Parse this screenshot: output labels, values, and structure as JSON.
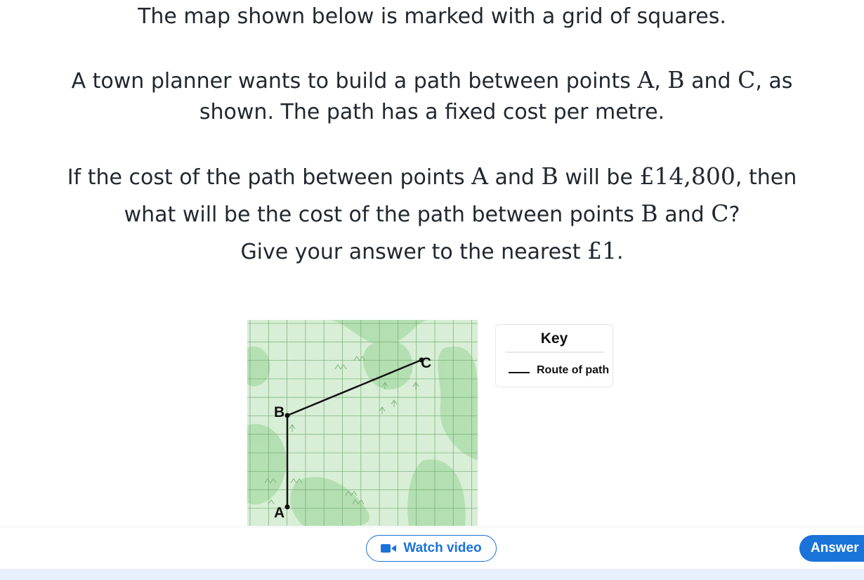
{
  "question": {
    "line1": "The map shown below is marked with a grid of squares.",
    "line2": {
      "pre": "A town planner wants to build a path between points ",
      "a": "A",
      "sep1": ", ",
      "b": "B",
      "and": " and ",
      "c": "C",
      "post": ", as"
    },
    "line3": "shown. The path has a fixed cost per metre.",
    "line4": {
      "pre": "If the cost of the path between points ",
      "a": "A",
      "and": " and ",
      "b": "B",
      "mid": " will be ",
      "cost": "£14,800",
      "post": ", then"
    },
    "line5": {
      "pre": "what will be the cost of the path between points ",
      "b": "B",
      "and": " and ",
      "c": "C",
      "post": "?"
    },
    "line6": {
      "pre": "Give your answer to the nearest ",
      "unit": "£1",
      "post": "."
    }
  },
  "map": {
    "points": {
      "a": "A",
      "b": "B",
      "c": "C"
    },
    "colors": {
      "background": "#d8eed6",
      "blob": "#a9dba6",
      "grid": "#6fa86d",
      "path": "#111111"
    }
  },
  "key": {
    "title": "Key",
    "route_label": "Route of path"
  },
  "buttons": {
    "watch_video": "Watch video",
    "watch_icon": "video-camera-icon",
    "answer": "Answer"
  },
  "colors": {
    "accent": "#1a73d9"
  }
}
